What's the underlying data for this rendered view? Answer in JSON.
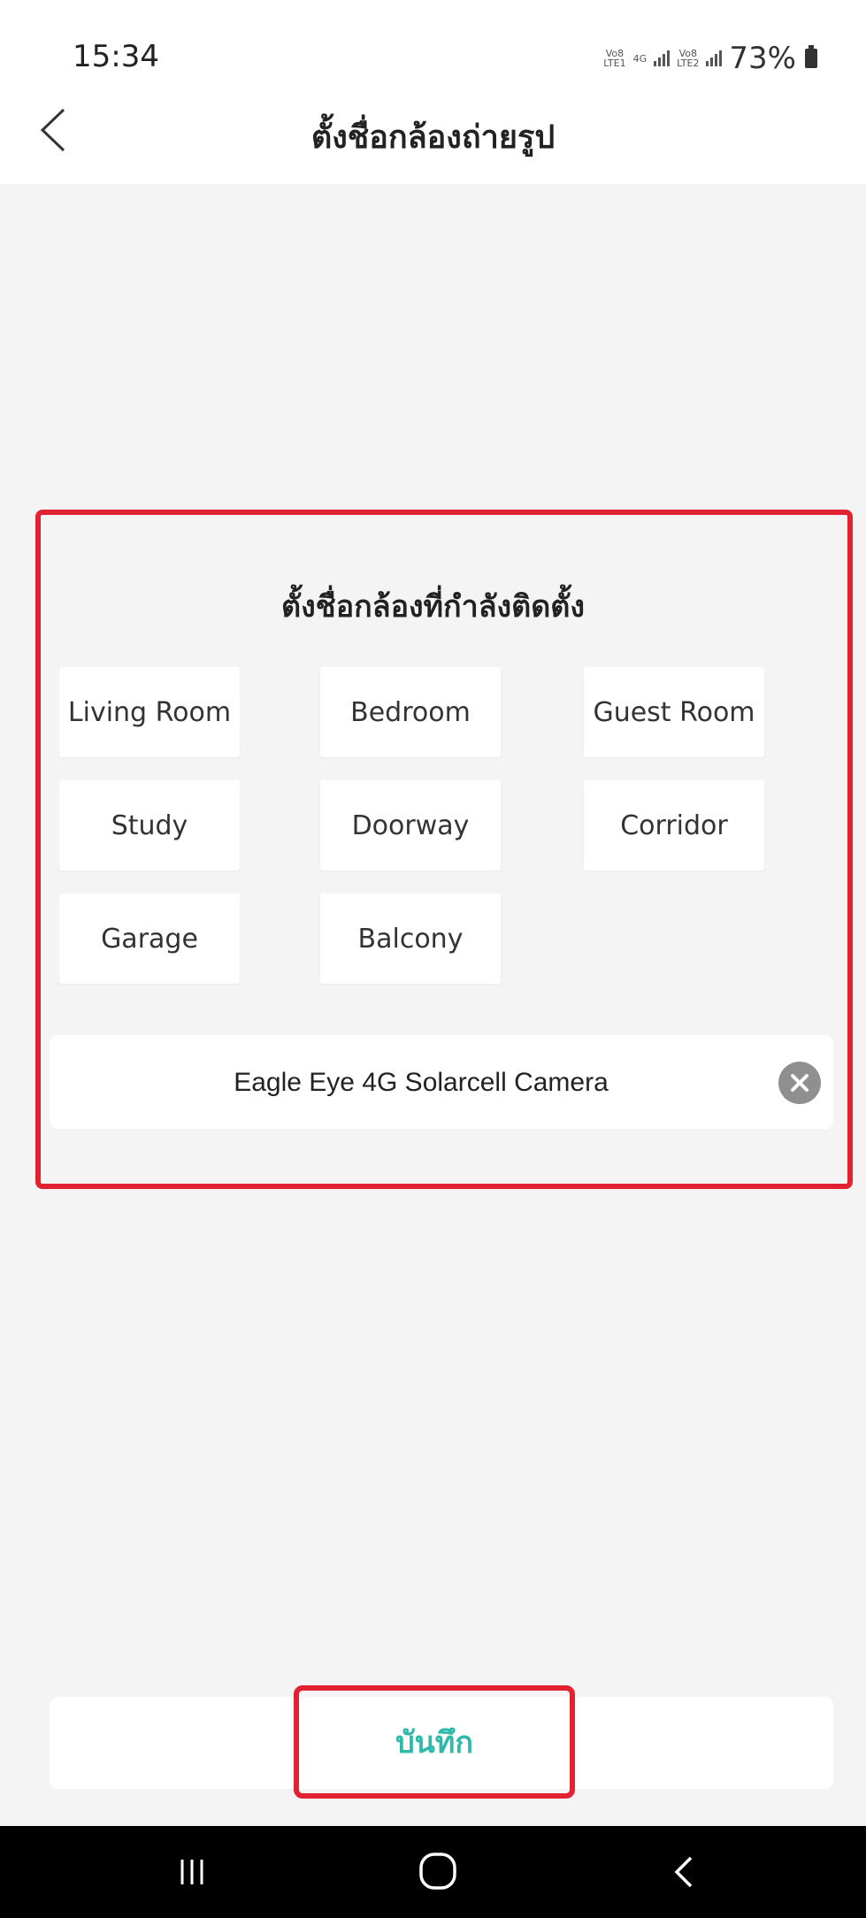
{
  "status_bar": {
    "time": "15:34",
    "network_sim1": "Vo8\nLTE1",
    "network_4g": "4G",
    "network_sim2": "Vo8\nLTE2",
    "battery": "73%"
  },
  "header": {
    "title": "ตั้งชื่อกล้องถ่ายรูป"
  },
  "section": {
    "title": "ตั้งชื่อกล้องที่กำลังติดตั้ง",
    "presets": [
      "Living Room",
      "Bedroom",
      "Guest Room",
      "Study",
      "Doorway",
      "Corridor",
      "Garage",
      "Balcony"
    ]
  },
  "name_input": {
    "value": "Eagle Eye 4G Solarcell Camera"
  },
  "actions": {
    "save_label": "บันทึก"
  },
  "colors": {
    "accent": "#2fb9aa",
    "highlight": "#e22230",
    "background": "#f4f4f4",
    "nav_bar": "#000000"
  },
  "icons": {
    "back": "chevron-left-icon",
    "clear": "clear-circle-icon",
    "nav_recent": "recent-apps-icon",
    "nav_home": "home-icon",
    "nav_back": "back-icon"
  }
}
